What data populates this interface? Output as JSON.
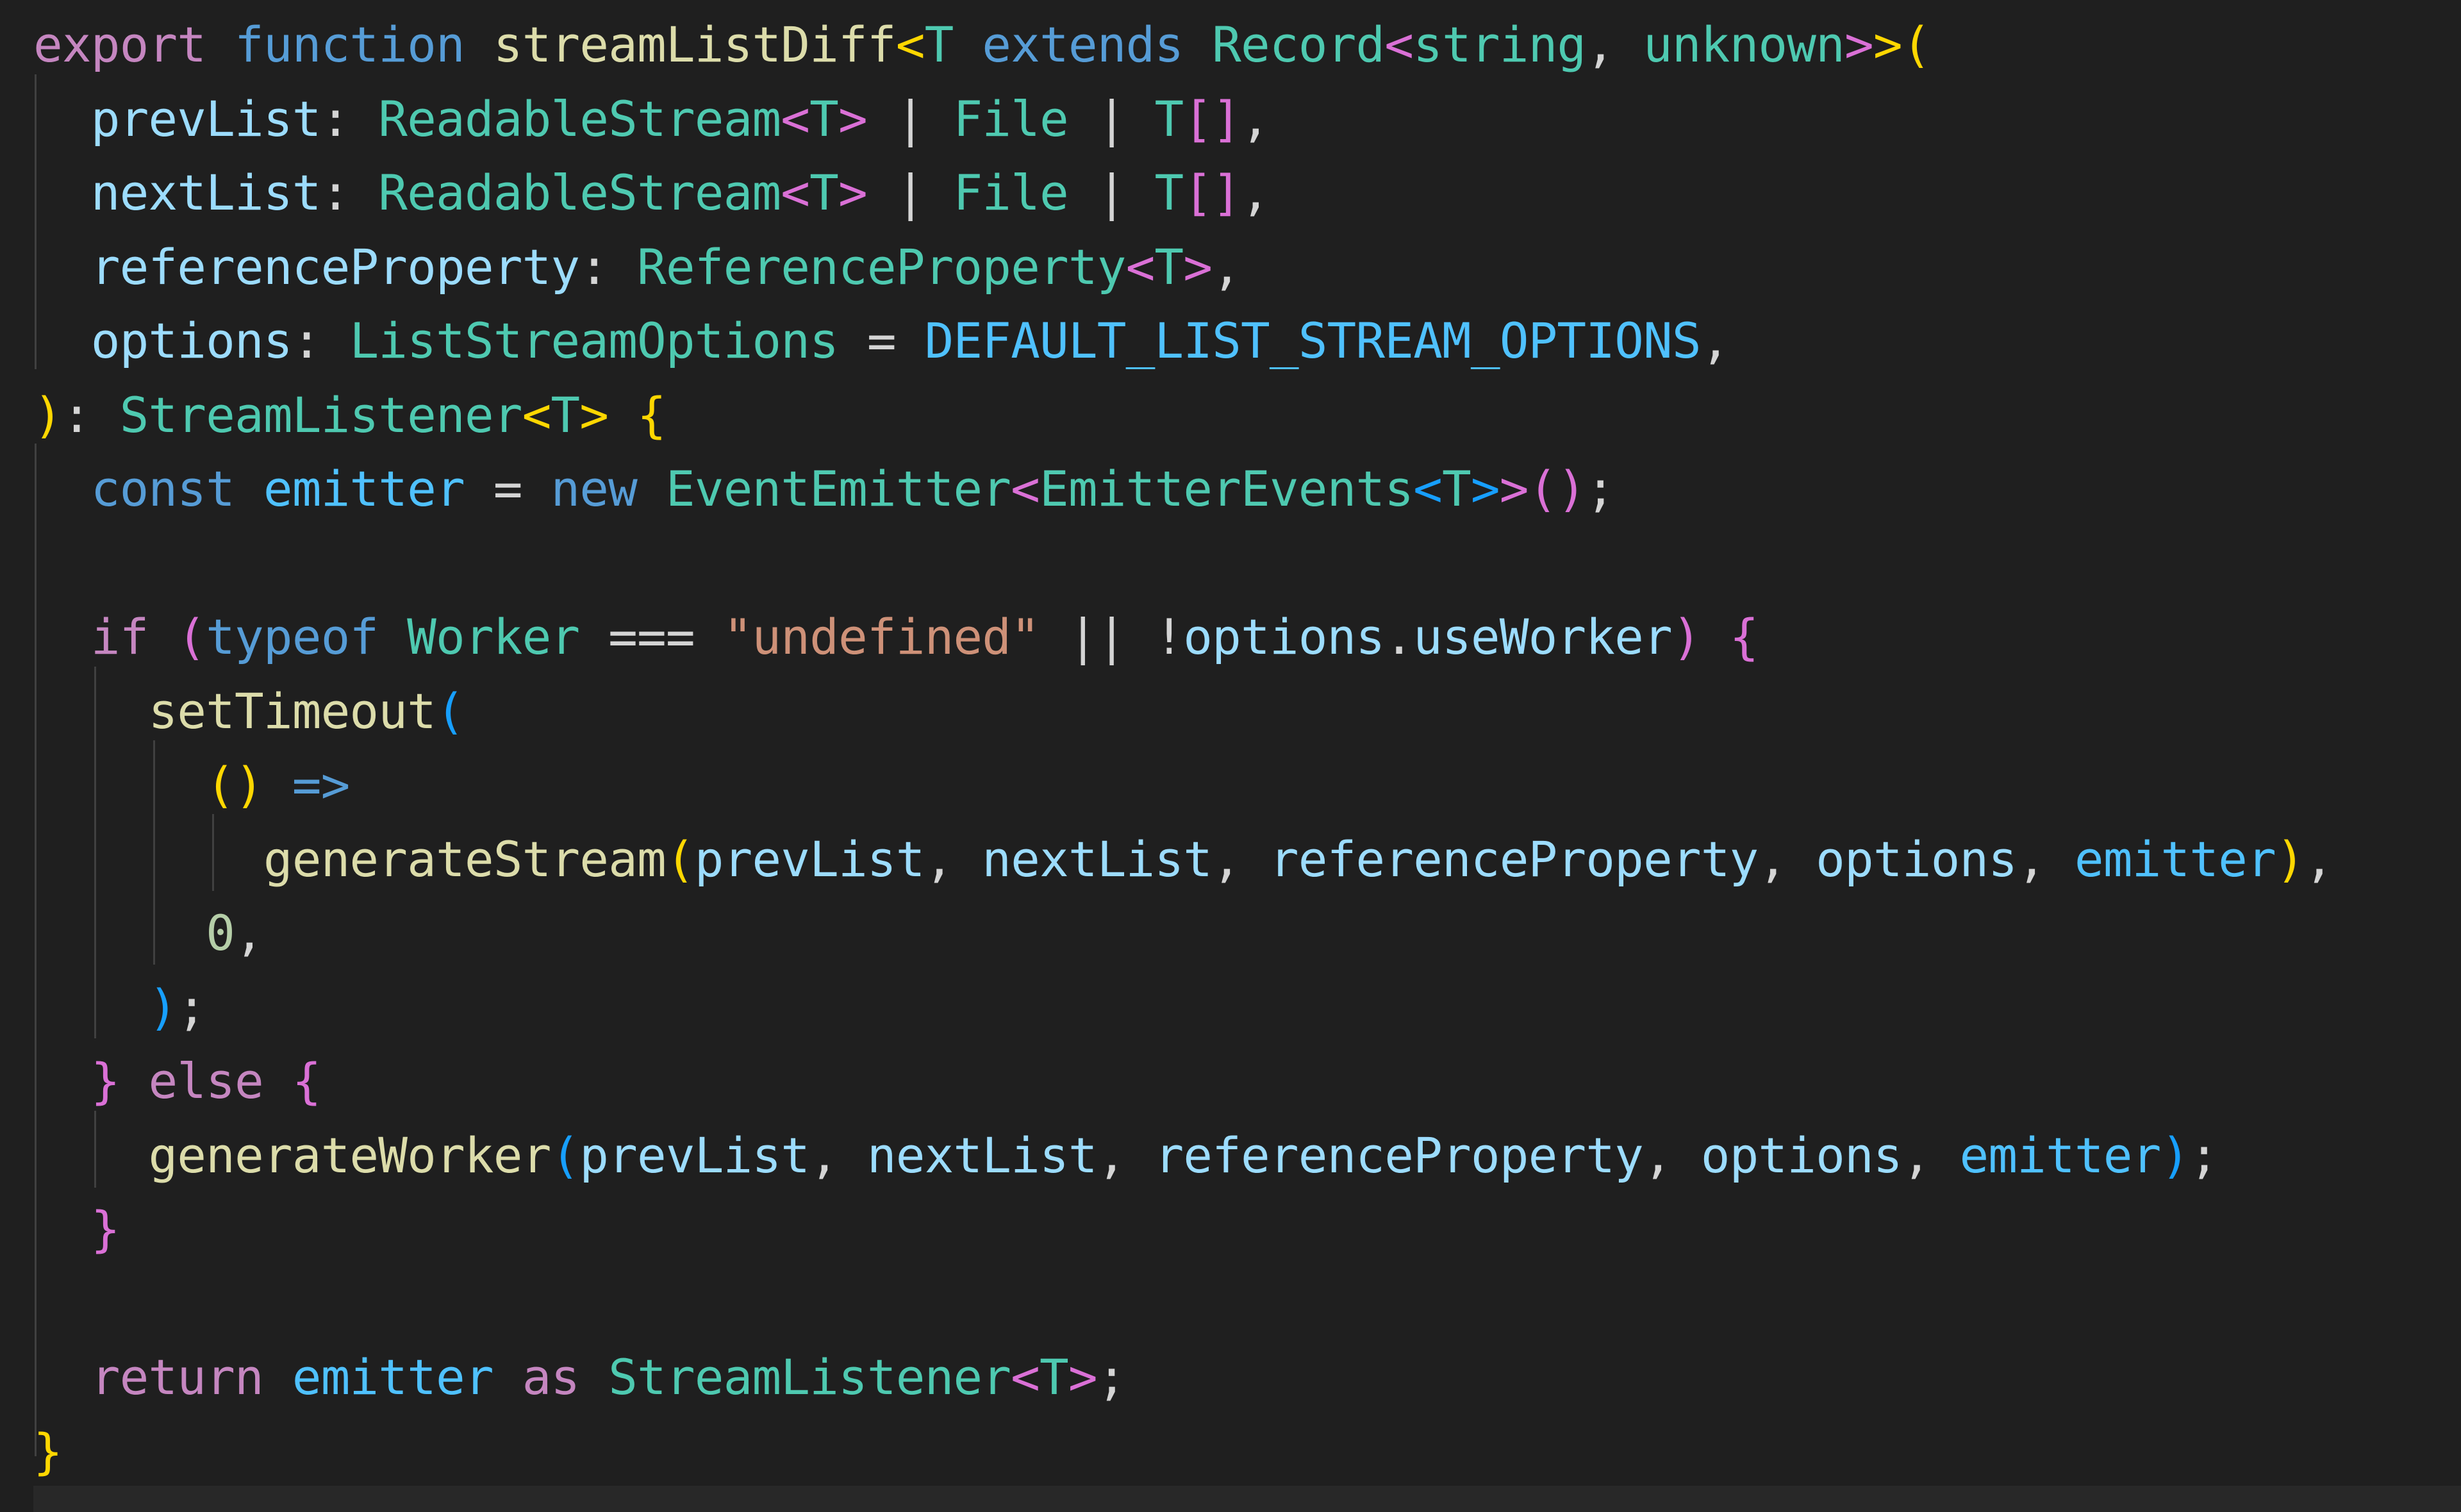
{
  "editor": {
    "language": "typescript",
    "colors": {
      "background": "#1f1f1f",
      "keyword_control": "#c586c0",
      "keyword_storage": "#569cd6",
      "function": "#dcdcaa",
      "type": "#4ec9b0",
      "variable": "#9cdcfe",
      "constant": "#4fc1ff",
      "string": "#ce9178",
      "number": "#b5cea8",
      "punctuation": "#d4d4d4",
      "bracket_gold": "#ffd700",
      "bracket_pink": "#da70d6",
      "bracket_blue": "#179fff"
    },
    "lines": [
      [
        [
          "export",
          "keyword_control"
        ],
        [
          " ",
          "punctuation"
        ],
        [
          "function",
          "keyword_storage"
        ],
        [
          " ",
          "punctuation"
        ],
        [
          "streamListDiff",
          "function"
        ],
        [
          "<",
          "bracket_gold"
        ],
        [
          "T",
          "type"
        ],
        [
          " ",
          "punctuation"
        ],
        [
          "extends",
          "keyword_storage"
        ],
        [
          " ",
          "punctuation"
        ],
        [
          "Record",
          "type"
        ],
        [
          "<",
          "bracket_pink"
        ],
        [
          "string",
          "type"
        ],
        [
          ", ",
          "punctuation"
        ],
        [
          "unknown",
          "type"
        ],
        [
          ">",
          "bracket_pink"
        ],
        [
          ">",
          "bracket_gold"
        ],
        [
          "(",
          "bracket_gold"
        ]
      ],
      [
        [
          "  ",
          "punctuation"
        ],
        [
          "prevList",
          "variable"
        ],
        [
          ": ",
          "punctuation"
        ],
        [
          "ReadableStream",
          "type"
        ],
        [
          "<",
          "bracket_pink"
        ],
        [
          "T",
          "type"
        ],
        [
          ">",
          "bracket_pink"
        ],
        [
          " | ",
          "punctuation"
        ],
        [
          "File",
          "type"
        ],
        [
          " | ",
          "punctuation"
        ],
        [
          "T",
          "type"
        ],
        [
          "[]",
          "bracket_pink"
        ],
        [
          ",",
          "punctuation"
        ]
      ],
      [
        [
          "  ",
          "punctuation"
        ],
        [
          "nextList",
          "variable"
        ],
        [
          ": ",
          "punctuation"
        ],
        [
          "ReadableStream",
          "type"
        ],
        [
          "<",
          "bracket_pink"
        ],
        [
          "T",
          "type"
        ],
        [
          ">",
          "bracket_pink"
        ],
        [
          " | ",
          "punctuation"
        ],
        [
          "File",
          "type"
        ],
        [
          " | ",
          "punctuation"
        ],
        [
          "T",
          "type"
        ],
        [
          "[]",
          "bracket_pink"
        ],
        [
          ",",
          "punctuation"
        ]
      ],
      [
        [
          "  ",
          "punctuation"
        ],
        [
          "referenceProperty",
          "variable"
        ],
        [
          ": ",
          "punctuation"
        ],
        [
          "ReferenceProperty",
          "type"
        ],
        [
          "<",
          "bracket_pink"
        ],
        [
          "T",
          "type"
        ],
        [
          ">",
          "bracket_pink"
        ],
        [
          ",",
          "punctuation"
        ]
      ],
      [
        [
          "  ",
          "punctuation"
        ],
        [
          "options",
          "variable"
        ],
        [
          ": ",
          "punctuation"
        ],
        [
          "ListStreamOptions",
          "type"
        ],
        [
          " = ",
          "punctuation"
        ],
        [
          "DEFAULT_LIST_STREAM_OPTIONS",
          "constant"
        ],
        [
          ",",
          "punctuation"
        ]
      ],
      [
        [
          ")",
          "bracket_gold"
        ],
        [
          ": ",
          "punctuation"
        ],
        [
          "StreamListener",
          "type"
        ],
        [
          "<",
          "bracket_gold"
        ],
        [
          "T",
          "type"
        ],
        [
          ">",
          "bracket_gold"
        ],
        [
          " ",
          "punctuation"
        ],
        [
          "{",
          "bracket_gold"
        ]
      ],
      [
        [
          "  ",
          "punctuation"
        ],
        [
          "const",
          "keyword_storage"
        ],
        [
          " ",
          "punctuation"
        ],
        [
          "emitter",
          "constant"
        ],
        [
          " = ",
          "punctuation"
        ],
        [
          "new",
          "keyword_storage"
        ],
        [
          " ",
          "punctuation"
        ],
        [
          "EventEmitter",
          "type"
        ],
        [
          "<",
          "bracket_pink"
        ],
        [
          "EmitterEvents",
          "type"
        ],
        [
          "<",
          "bracket_blue"
        ],
        [
          "T",
          "type"
        ],
        [
          ">",
          "bracket_blue"
        ],
        [
          ">",
          "bracket_pink"
        ],
        [
          "()",
          "bracket_pink"
        ],
        [
          ";",
          "punctuation"
        ]
      ],
      [],
      [
        [
          "  ",
          "punctuation"
        ],
        [
          "if",
          "keyword_control"
        ],
        [
          " ",
          "punctuation"
        ],
        [
          "(",
          "bracket_pink"
        ],
        [
          "typeof",
          "keyword_storage"
        ],
        [
          " ",
          "punctuation"
        ],
        [
          "Worker",
          "type"
        ],
        [
          " === ",
          "punctuation"
        ],
        [
          "\"undefined\"",
          "string"
        ],
        [
          " || !",
          "punctuation"
        ],
        [
          "options",
          "variable"
        ],
        [
          ".",
          "punctuation"
        ],
        [
          "useWorker",
          "variable"
        ],
        [
          ")",
          "bracket_pink"
        ],
        [
          " ",
          "punctuation"
        ],
        [
          "{",
          "bracket_pink"
        ]
      ],
      [
        [
          "    ",
          "punctuation"
        ],
        [
          "setTimeout",
          "function"
        ],
        [
          "(",
          "bracket_blue"
        ]
      ],
      [
        [
          "      ",
          "punctuation"
        ],
        [
          "()",
          "bracket_gold"
        ],
        [
          " ",
          "punctuation"
        ],
        [
          "=>",
          "keyword_storage"
        ]
      ],
      [
        [
          "        ",
          "punctuation"
        ],
        [
          "generateStream",
          "function"
        ],
        [
          "(",
          "bracket_gold"
        ],
        [
          "prevList",
          "variable"
        ],
        [
          ", ",
          "punctuation"
        ],
        [
          "nextList",
          "variable"
        ],
        [
          ", ",
          "punctuation"
        ],
        [
          "referenceProperty",
          "variable"
        ],
        [
          ", ",
          "punctuation"
        ],
        [
          "options",
          "variable"
        ],
        [
          ", ",
          "punctuation"
        ],
        [
          "emitter",
          "constant"
        ],
        [
          ")",
          "bracket_gold"
        ],
        [
          ",",
          "punctuation"
        ]
      ],
      [
        [
          "      ",
          "punctuation"
        ],
        [
          "0",
          "number"
        ],
        [
          ",",
          "punctuation"
        ]
      ],
      [
        [
          "    ",
          "punctuation"
        ],
        [
          ")",
          "bracket_blue"
        ],
        [
          ";",
          "punctuation"
        ]
      ],
      [
        [
          "  ",
          "punctuation"
        ],
        [
          "}",
          "bracket_pink"
        ],
        [
          " ",
          "punctuation"
        ],
        [
          "else",
          "keyword_control"
        ],
        [
          " ",
          "punctuation"
        ],
        [
          "{",
          "bracket_pink"
        ]
      ],
      [
        [
          "    ",
          "punctuation"
        ],
        [
          "generateWorker",
          "function"
        ],
        [
          "(",
          "bracket_blue"
        ],
        [
          "prevList",
          "variable"
        ],
        [
          ", ",
          "punctuation"
        ],
        [
          "nextList",
          "variable"
        ],
        [
          ", ",
          "punctuation"
        ],
        [
          "referenceProperty",
          "variable"
        ],
        [
          ", ",
          "punctuation"
        ],
        [
          "options",
          "variable"
        ],
        [
          ", ",
          "punctuation"
        ],
        [
          "emitter",
          "constant"
        ],
        [
          ")",
          "bracket_blue"
        ],
        [
          ";",
          "punctuation"
        ]
      ],
      [
        [
          "  ",
          "punctuation"
        ],
        [
          "}",
          "bracket_pink"
        ]
      ],
      [],
      [
        [
          "  ",
          "punctuation"
        ],
        [
          "return",
          "keyword_control"
        ],
        [
          " ",
          "punctuation"
        ],
        [
          "emitter",
          "constant"
        ],
        [
          " ",
          "punctuation"
        ],
        [
          "as",
          "keyword_control"
        ],
        [
          " ",
          "punctuation"
        ],
        [
          "StreamListener",
          "type"
        ],
        [
          "<",
          "bracket_pink"
        ],
        [
          "T",
          "type"
        ],
        [
          ">",
          "bracket_pink"
        ],
        [
          ";",
          "punctuation"
        ]
      ],
      [
        [
          "}",
          "bracket_gold"
        ]
      ]
    ]
  }
}
